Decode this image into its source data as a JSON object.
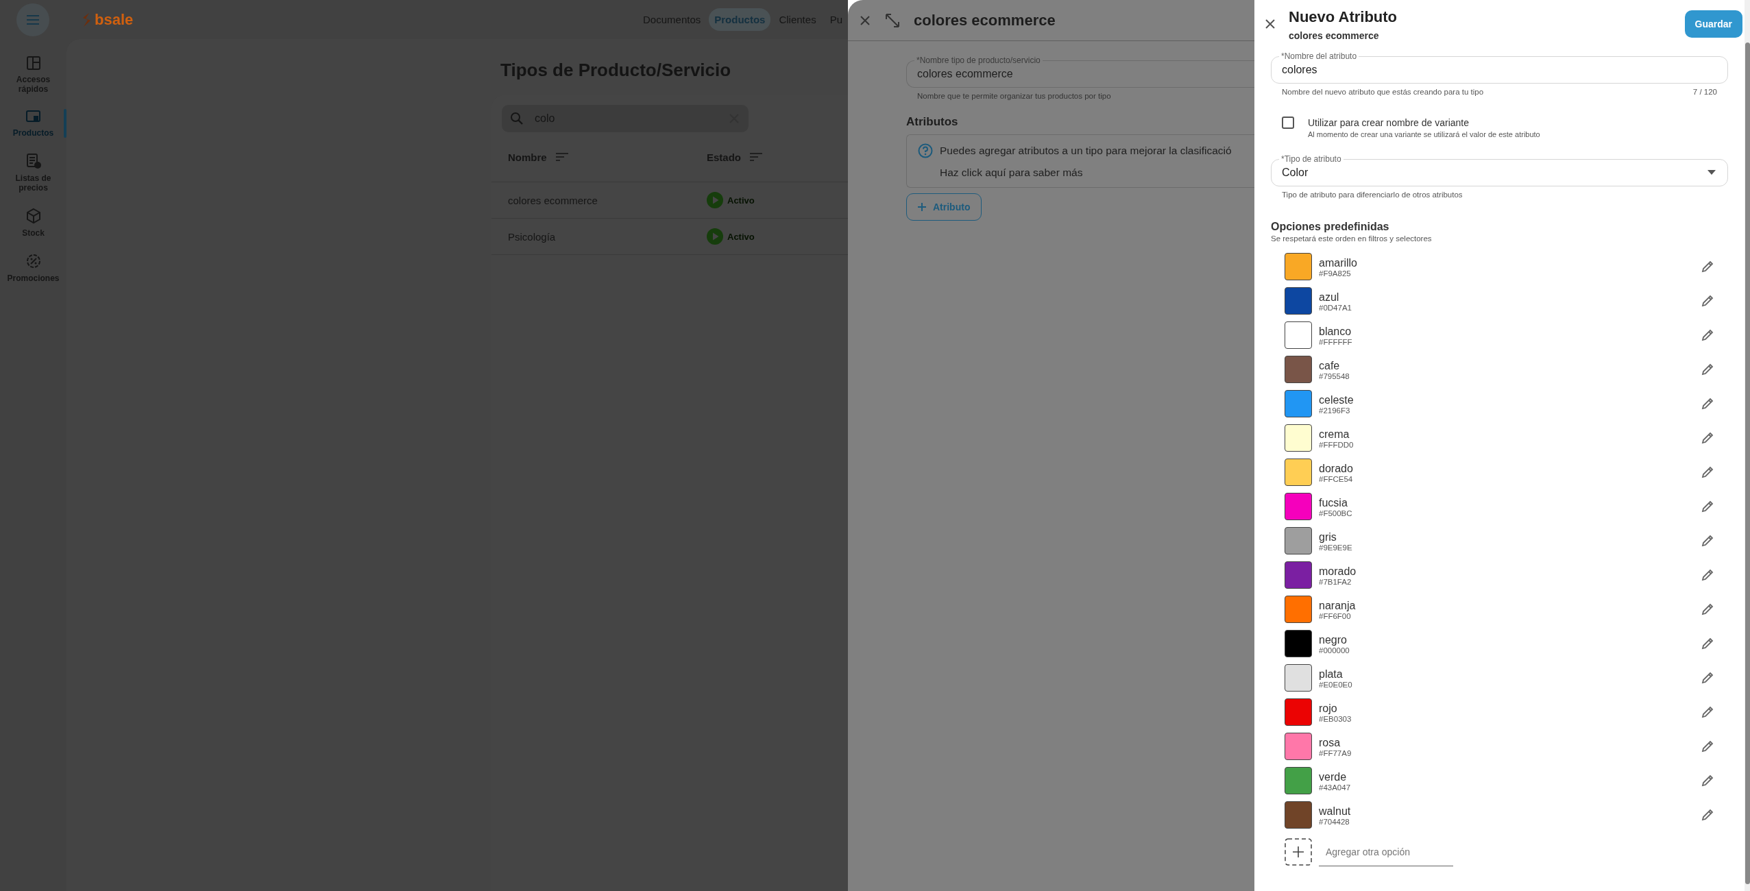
{
  "topbar": {
    "logo": "bsale",
    "nav": [
      {
        "label": "Documentos",
        "selected": false
      },
      {
        "label": "Productos",
        "selected": true
      },
      {
        "label": "Clientes",
        "selected": false
      },
      {
        "label": "Pu",
        "selected": false
      }
    ]
  },
  "sidebar": {
    "items": [
      {
        "kind": "grid",
        "label": "Accesos rápidos",
        "selected": false
      },
      {
        "kind": "product",
        "label": "Productos",
        "selected": true
      },
      {
        "kind": "list",
        "label": "Listas de precios",
        "selected": false
      },
      {
        "kind": "box",
        "label": "Stock",
        "selected": false
      },
      {
        "kind": "percent",
        "label": "Promociones",
        "selected": false
      }
    ]
  },
  "page": {
    "title": "Tipos de Producto/Servicio",
    "search": {
      "value": "colo"
    },
    "table": {
      "columns": [
        "Nombre",
        "Estado"
      ],
      "rows": [
        {
          "name": "colores ecommerce",
          "status": "Activo"
        },
        {
          "name": "Psicología",
          "status": "Activo"
        }
      ]
    }
  },
  "type_panel": {
    "title": "colores ecommerce",
    "name_field": {
      "label": "*Nombre tipo de producto/servicio",
      "value": "colores ecommerce",
      "helper": "Nombre que te permite organizar tus productos por tipo"
    },
    "attributes_heading": "Atributos",
    "info": [
      "Puedes agregar atributos a un tipo para mejorar la clasificació",
      "Haz click aquí para saber más"
    ],
    "add_button": "Atributo"
  },
  "attribute_panel": {
    "title": "Nuevo Atributo",
    "subtitle": "colores ecommerce",
    "save_button": "Guardar",
    "name_field": {
      "label": "*Nombre del atributo",
      "value": "colores",
      "helper": "Nombre del nuevo atributo que estás creando para tu tipo",
      "counter": "7 / 120"
    },
    "variant_checkbox": {
      "label": "Utilizar para crear nombre de variante",
      "description": "Al momento de crear una variante se utilizará el valor de este atributo",
      "checked": false
    },
    "type_field": {
      "label": "*Tipo de atributo",
      "value": "Color",
      "helper": "Tipo de atributo para diferenciarlo de otros atributos"
    },
    "options_heading": "Opciones predefinidas",
    "options_subtitle": "Se respetará este orden en filtros y selectores",
    "options": [
      {
        "name": "amarillo",
        "hex": "#F9A825",
        "color": "#f9a825"
      },
      {
        "name": "azul",
        "hex": "#0D47A1",
        "color": "#0d47a1"
      },
      {
        "name": "blanco",
        "hex": "#FFFFFF",
        "color": "#ffffff"
      },
      {
        "name": "cafe",
        "hex": "#795548",
        "color": "#795548"
      },
      {
        "name": "celeste",
        "hex": "#2196F3",
        "color": "#2196f3"
      },
      {
        "name": "crema",
        "hex": "#FFFDD0",
        "color": "#fffdd0"
      },
      {
        "name": "dorado",
        "hex": "#FFCE54",
        "color": "#ffce54"
      },
      {
        "name": "fucsia",
        "hex": "#F500BC",
        "color": "#f500bc"
      },
      {
        "name": "gris",
        "hex": "#9E9E9E",
        "color": "#9e9e9e"
      },
      {
        "name": "morado",
        "hex": "#7B1FA2",
        "color": "#7b1fa2"
      },
      {
        "name": "naranja",
        "hex": "#FF6F00",
        "color": "#ff6f00"
      },
      {
        "name": "negro",
        "hex": "#000000",
        "color": "#000000"
      },
      {
        "name": "plata",
        "hex": "#E0E0E0",
        "color": "#e0e0e0"
      },
      {
        "name": "rojo",
        "hex": "#EB0303",
        "color": "#eb0303"
      },
      {
        "name": "rosa",
        "hex": "#FF77A9",
        "color": "#ff77a9"
      },
      {
        "name": "verde",
        "hex": "#43A047",
        "color": "#43a047"
      },
      {
        "name": "walnut",
        "hex": "#704428",
        "color": "#704428"
      }
    ],
    "add_option": {
      "placeholder": "Agregar otra opción"
    }
  }
}
